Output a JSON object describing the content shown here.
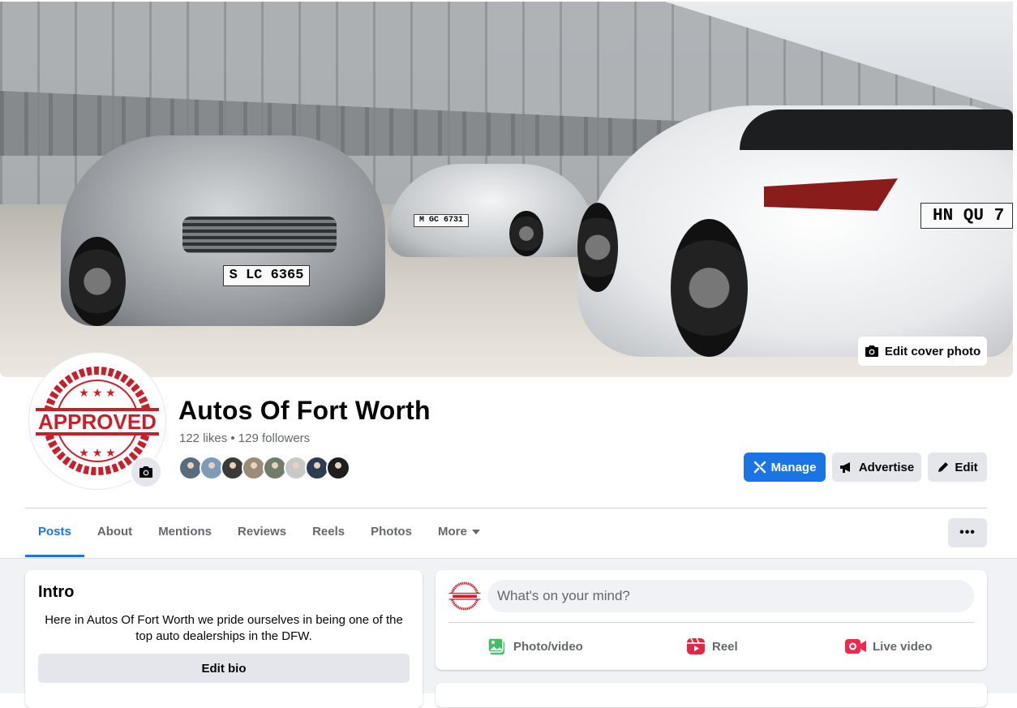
{
  "cover": {
    "edit_label": "Edit cover photo",
    "plate_left": "S LC 6365",
    "plate_right": "HN QU 7",
    "plate_mid": "M GC 6731"
  },
  "profile": {
    "logo_text": "APPROVED",
    "name": "Autos Of Fort Worth",
    "stats": "122 likes • 129 followers",
    "follower_face_colors": [
      "#5a6b80",
      "#7e9bb8",
      "#3a3a3a",
      "#9a8c78",
      "#6f7d6a",
      "#c8c8c8",
      "#2e3b55",
      "#1e1e1e"
    ]
  },
  "actions": {
    "manage": "Manage",
    "advertise": "Advertise",
    "edit": "Edit"
  },
  "tabs": [
    {
      "label": "Posts",
      "active": true
    },
    {
      "label": "About"
    },
    {
      "label": "Mentions"
    },
    {
      "label": "Reviews"
    },
    {
      "label": "Reels"
    },
    {
      "label": "Photos"
    },
    {
      "label": "More"
    }
  ],
  "more_dots": "•••",
  "intro": {
    "title": "Intro",
    "bio": "Here in Autos Of Fort Worth we pride ourselves in being one of the top auto dealerships in the DFW.",
    "edit_bio": "Edit bio"
  },
  "composer": {
    "placeholder": "What's on your mind?",
    "photo_video": "Photo/video",
    "reel": "Reel",
    "live_video": "Live video"
  },
  "colors": {
    "accent": "#1b74e4",
    "logo_red": "#c8202a",
    "photo_green": "#45bd62",
    "reel_pink": "#e42645",
    "live_red": "#f02849"
  }
}
